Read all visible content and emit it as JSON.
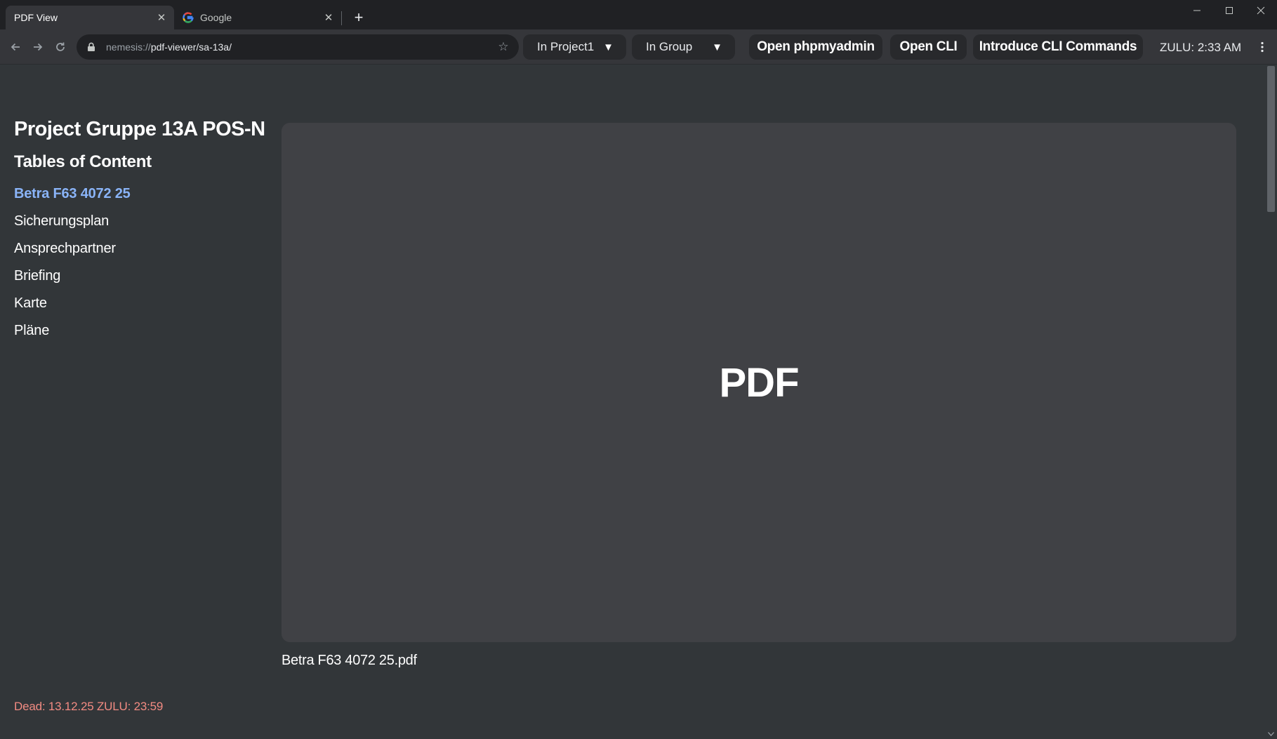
{
  "browser": {
    "tabs": [
      {
        "title": "PDF View",
        "active": true,
        "close_icon": "close-icon"
      },
      {
        "title": "Google",
        "active": false,
        "favicon": "google-g-icon",
        "close_icon": "close-icon"
      }
    ],
    "new_tab_icon": "plus-icon",
    "window_controls": [
      "minimize-icon",
      "maximize-icon",
      "close-icon"
    ],
    "nav_icons": [
      "back-arrow-icon",
      "forward-arrow-icon",
      "reload-icon"
    ],
    "omnibox": {
      "scheme": "nemesis://",
      "path": "pdf-viewer/sa-13a/",
      "lock_icon": "lock-icon",
      "bookmark_icon": "star-icon"
    }
  },
  "toolbar": {
    "project_select": {
      "value": "In Project1",
      "arrow": "▼"
    },
    "group_select": {
      "value": "In Group",
      "arrow": "▼"
    },
    "open_phpmyadmin_label": "Open phpmyadmin",
    "open_cli_label": "Open CLI",
    "introduce_cli_label": "Introduce CLI Commands",
    "zulu_time": "ZULU: 2:33 AM",
    "menu_icon": "kebab-menu-icon"
  },
  "sidebar": {
    "project_title": "Project Gruppe 13A POS-N",
    "toc_heading": "Tables of Content",
    "items": [
      {
        "label": "Betra F63 4072 25",
        "active": true
      },
      {
        "label": "Sicherungsplan",
        "active": false
      },
      {
        "label": "Ansprechpartner",
        "active": false
      },
      {
        "label": "Briefing",
        "active": false
      },
      {
        "label": "Karte",
        "active": false
      },
      {
        "label": "Pläne",
        "active": false
      }
    ],
    "deadline": "Dead: 13.12.25 ZULU: 23:59"
  },
  "viewer": {
    "placeholder": "PDF",
    "filename": "Betra F63 4072 25.pdf"
  },
  "colors": {
    "accent_link": "#8ab4f8",
    "deadline_red": "#f28b82",
    "page_bg": "#323639",
    "pdf_frame_bg": "#404145"
  }
}
